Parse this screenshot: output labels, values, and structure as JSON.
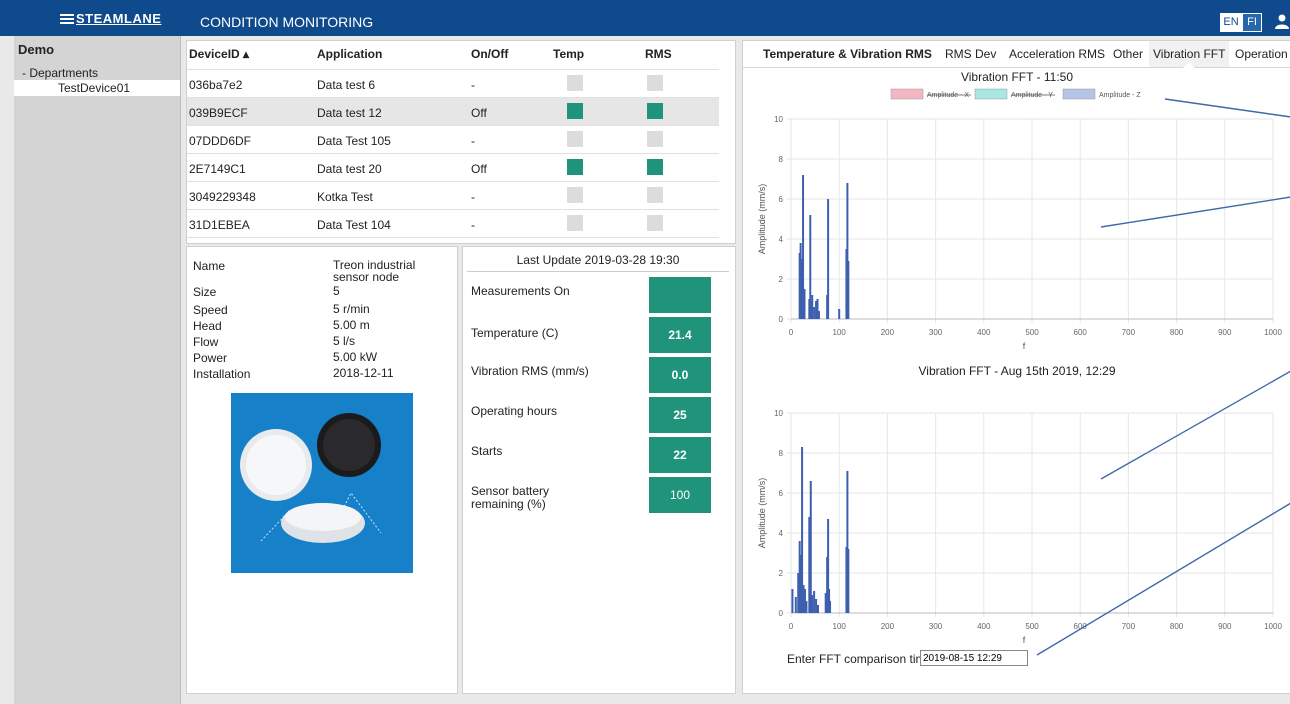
{
  "header": {
    "brand": "STEAMLANE",
    "title": "CONDITION MONITORING",
    "lang_en": "EN",
    "lang_fi": "FI"
  },
  "sidebar": {
    "root": "Demo",
    "department": "- Departments",
    "device": "TestDevice01"
  },
  "device_table": {
    "columns": [
      "DeviceID ▴",
      "Application",
      "On/Off",
      "Temp",
      "RMS"
    ],
    "rows": [
      {
        "id": "036ba7e2",
        "app": "Data test 6",
        "onoff": "-",
        "temp": false,
        "rms": false
      },
      {
        "id": "039B9ECF",
        "app": "Data test 12",
        "onoff": "Off",
        "temp": true,
        "rms": true
      },
      {
        "id": "07DDD6DF",
        "app": "Data Test 105",
        "onoff": "-",
        "temp": false,
        "rms": false
      },
      {
        "id": "2E7149C1",
        "app": "Data test 20",
        "onoff": "Off",
        "temp": true,
        "rms": true
      },
      {
        "id": "3049229348",
        "app": "Kotka Test",
        "onoff": "-",
        "temp": false,
        "rms": false
      },
      {
        "id": "31D1EBEA",
        "app": "Data Test 104",
        "onoff": "-",
        "temp": false,
        "rms": false
      }
    ]
  },
  "device_info": {
    "labels": [
      "Name",
      "Size",
      "Speed",
      "Head",
      "Flow",
      "Power",
      "Installation"
    ],
    "name": "Treon industrial sensor node",
    "size": "5",
    "speed": "5 r/min",
    "head": "5.00 m",
    "flow": "5 l/s",
    "power": "5.00 kW",
    "installation": "2018-12-11"
  },
  "measurements": {
    "last_update": "Last Update 2019-03-28 19:30",
    "items": [
      {
        "label": "Measurements On",
        "value": ""
      },
      {
        "label": "Temperature (C)",
        "value": "21.4"
      },
      {
        "label": "Vibration RMS (mm/s)",
        "value": "0.0"
      },
      {
        "label": "Operating hours",
        "value": "25"
      },
      {
        "label": "Starts",
        "value": "22"
      },
      {
        "label": "Sensor battery remaining (%)",
        "value": "100"
      }
    ]
  },
  "chart_tabs": [
    "Temperature & Vibration RMS",
    "RMS Dev",
    "Acceleration RMS",
    "Other",
    "Vibration FFT",
    "Operation"
  ],
  "active_tab": "Vibration FFT",
  "fft_compare": {
    "label": "Enter FFT comparison time:",
    "value": "2019-08-15 12:29"
  },
  "colors": {
    "header": "#0f4a8c",
    "status_on": "#1f947a",
    "series_z": "#3e5fb0"
  },
  "chart_data": [
    {
      "type": "bar",
      "title": "Vibration FFT - 11:50",
      "xlabel": "f",
      "ylabel": "Amplitude (mm/s)",
      "xlim": [
        0,
        1000
      ],
      "ylim": [
        0,
        10
      ],
      "xticks": [
        0,
        100,
        200,
        300,
        400,
        500,
        600,
        700,
        800,
        900,
        1000
      ],
      "yticks": [
        0,
        2,
        4,
        6,
        8,
        10
      ],
      "legend": [
        "Amplitude - X",
        "Amplitude - Y",
        "Amplitude - Z"
      ],
      "legend_hidden": [
        true,
        true,
        false
      ],
      "legend_colors": [
        "#f4b6c0",
        "#a8e8df",
        "#b5c3e6"
      ],
      "series": [
        {
          "name": "Amplitude - Z",
          "x": [
            18,
            20,
            22,
            25,
            28,
            38,
            40,
            42,
            44,
            48,
            52,
            55,
            58,
            75,
            77,
            100,
            115,
            117,
            119
          ],
          "y": [
            3.3,
            3.8,
            3.0,
            7.2,
            1.5,
            1.0,
            5.2,
            0.9,
            1.2,
            0.6,
            0.9,
            1.0,
            0.4,
            1.2,
            6.0,
            0.5,
            3.5,
            6.8,
            2.9
          ]
        }
      ]
    },
    {
      "type": "bar",
      "title": "Vibration FFT - Aug 15th 2019, 12:29",
      "xlabel": "f",
      "ylabel": "Amplitude (mm/s)",
      "xlim": [
        0,
        1000
      ],
      "ylim": [
        0,
        10
      ],
      "xticks": [
        0,
        100,
        200,
        300,
        400,
        500,
        600,
        700,
        800,
        900,
        1000
      ],
      "yticks": [
        0,
        2,
        4,
        6,
        8,
        10
      ],
      "series": [
        {
          "name": "Amplitude - Z",
          "x": [
            3,
            10,
            15,
            18,
            21,
            23,
            26,
            29,
            32,
            38,
            41,
            44,
            48,
            52,
            56,
            72,
            75,
            77,
            79,
            81,
            115,
            117,
            119
          ],
          "y": [
            1.2,
            0.8,
            2.0,
            3.6,
            2.9,
            8.3,
            1.4,
            1.2,
            0.6,
            4.8,
            6.6,
            0.9,
            1.1,
            0.7,
            0.4,
            1.0,
            2.8,
            4.7,
            1.2,
            0.6,
            3.3,
            7.1,
            3.2
          ]
        }
      ]
    }
  ]
}
